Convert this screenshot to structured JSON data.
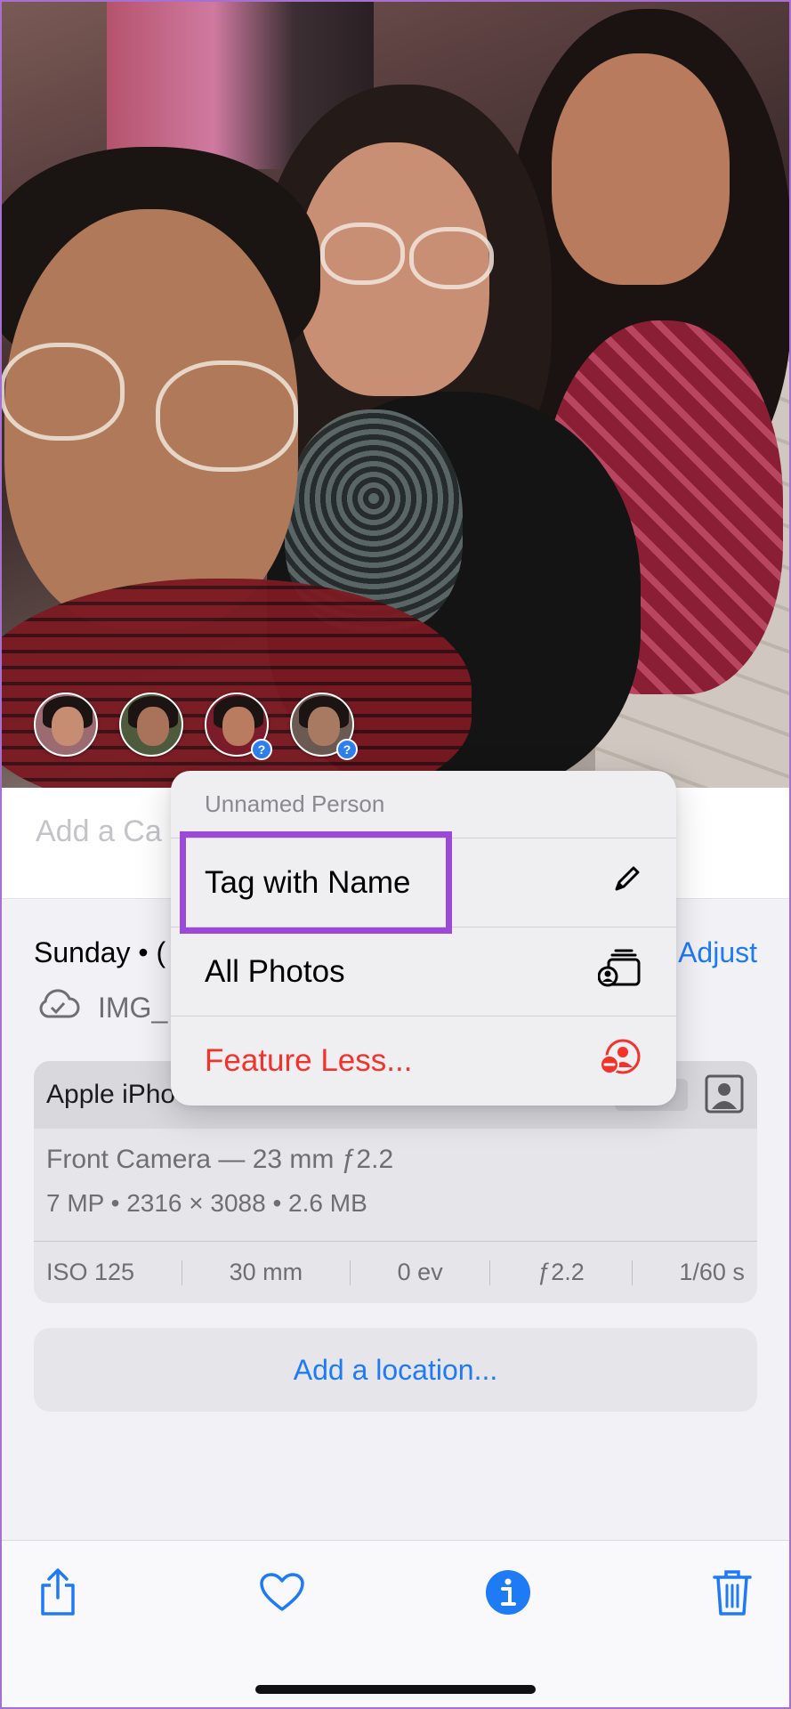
{
  "photo": {
    "faces": [
      {
        "name": "person-face-1",
        "has_badge": false
      },
      {
        "name": "person-face-2",
        "has_badge": false
      },
      {
        "name": "person-face-3",
        "has_badge": true,
        "badge": "?"
      },
      {
        "name": "person-face-4",
        "has_badge": true,
        "badge": "?"
      }
    ]
  },
  "caption": {
    "placeholder": "Add a Ca"
  },
  "info": {
    "date": "Sunday • (",
    "adjust_label": "Adjust",
    "filename": "IMG_"
  },
  "camera": {
    "model": "Apple iPho",
    "lens": "Front Camera — 23 mm ƒ2.2",
    "specs": "7 MP  •  2316 × 3088  •  2.6 MB",
    "stats": [
      "ISO 125",
      "30 mm",
      "0 ev",
      "ƒ2.2",
      "1/60 s"
    ]
  },
  "location": {
    "label": "Add a location..."
  },
  "menu": {
    "title": "Unnamed Person",
    "items": [
      {
        "label": "Tag with Name",
        "icon": "pencil-icon"
      },
      {
        "label": "All Photos",
        "icon": "person-stack-icon"
      },
      {
        "label": "Feature Less...",
        "icon": "person-minus-icon"
      }
    ]
  },
  "colors": {
    "accent": "#1f7af6",
    "destructive": "#f2322b",
    "highlight": "#9b49d6"
  },
  "toolbar": {
    "icons": [
      "share-icon",
      "heart-icon",
      "info-icon",
      "trash-icon"
    ]
  }
}
